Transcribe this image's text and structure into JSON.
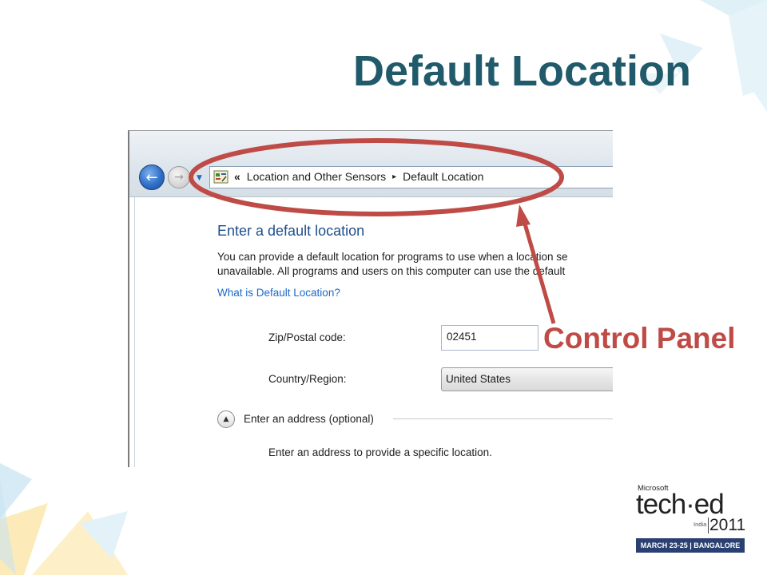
{
  "slide": {
    "title": "Default Location",
    "annotation_label": "Control Panel",
    "annotation_color": "#bf4b47",
    "title_color": "#215b6b"
  },
  "window": {
    "nav": {
      "back_icon": "back-arrow-icon",
      "forward_icon": "forward-arrow-icon",
      "recent_pages_icon": "chevron-down-icon"
    },
    "address_bar": {
      "icon": "control-panel-icon",
      "overflow_glyph": "«",
      "separator_glyph": "▸",
      "crumbs": [
        "Location and Other Sensors",
        "Default Location"
      ]
    },
    "content": {
      "heading": "Enter a default location",
      "description_line1": "You can provide a default location for programs to use when a location se",
      "description_line2": "unavailable. All programs and users on this computer can use the default",
      "help_link": "What is Default Location?",
      "zip_label": "Zip/Postal code:",
      "zip_value": "02451",
      "country_label": "Country/Region:",
      "country_value": "United States",
      "address_section_label": "Enter an address (optional)",
      "address_hint": "Enter an address to provide a specific location."
    }
  },
  "logo": {
    "brand": "Microsoft",
    "product": "tech·ed",
    "region": "India",
    "year": "2011",
    "band": "MARCH 23-25 | BANGALORE",
    "band_color": "#2a3f72"
  }
}
